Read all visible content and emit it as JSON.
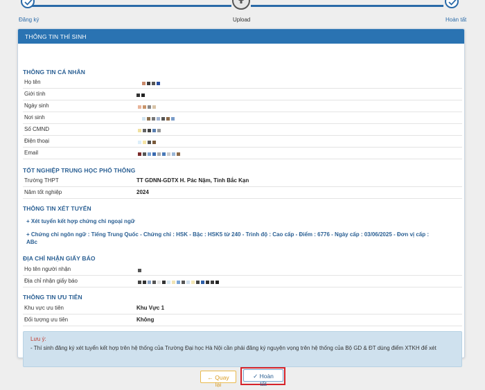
{
  "steps": {
    "left_label": "Đăng ký",
    "middle_label": "Upload",
    "right_label": "Hoàn tất"
  },
  "panel": {
    "title": "THÔNG TIN THÍ SINH"
  },
  "personal": {
    "section_title": "THÔNG TIN CÁ NHÂN",
    "labels": [
      "Họ tên",
      "Giới tính",
      "Ngày sinh",
      "Nơi sinh",
      "Số CMND",
      "Điện thoại",
      "Email"
    ]
  },
  "highschool": {
    "section_title": "TỐT NGHIỆP TRUNG HỌC PHỔ THÔNG",
    "school_label": "Trường THPT",
    "school_value": "TT GDNN-GDTX H. Pác Nặm, Tỉnh Bắc Kạn",
    "year_label": "Năm tốt nghiệp",
    "year_value": "2024"
  },
  "admission": {
    "section_title": "THÔNG TIN XÉT TUYỂN",
    "line1": "+ Xét tuyển kết hợp chứng chỉ ngoại ngữ",
    "line2a": "+ Chứng chỉ ngôn ngữ : Tiếng Trung Quốc - Chứng chỉ : HSK - Bậc : HSK5 từ 240 - Trình độ : Cao cấp - Điểm : 6776 - Ngày cấp : 03/06/2025 - Đơn vị cấp :",
    "line2b": "ABc"
  },
  "mailing": {
    "section_title": "ĐỊA CHỈ NHẬN GIẤY BÁO",
    "receiver_label": "Họ tên người nhận",
    "address_label": "Địa chỉ nhận giấy báo"
  },
  "priority": {
    "section_title": "THÔNG TIN ƯU TIÊN",
    "area_label": "Khu vực ưu tiên",
    "area_value": "Khu Vực 1",
    "object_label": "Đối tượng ưu tiên",
    "object_value": "Không"
  },
  "note": {
    "title": "Lưu ý:",
    "text": "- Thí sinh đăng ký xét tuyển kết hợp trên hệ thống của Trường Đại học Hà Nội cần phải đăng ký nguyện vọng trên hệ thống của Bộ GD & ĐT dùng điểm XTKH để xét"
  },
  "buttons": {
    "back_label": "Quay lại",
    "finish_label": "Hoàn tất"
  },
  "colors": {
    "accent": "#2a73b2",
    "section_title": "#2a5f93",
    "note_bg": "#cfe1ee",
    "highlight_border": "#d6232a"
  }
}
